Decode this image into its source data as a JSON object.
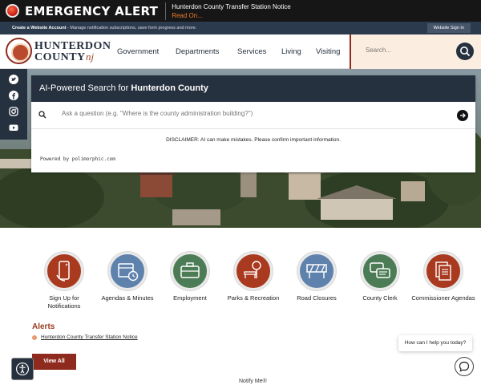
{
  "emergency": {
    "title": "EMERGENCY ALERT",
    "notice": "Hunterdon County Transfer Station Notice",
    "read_on": "Read On..."
  },
  "account_bar": {
    "create_link": "Create a Website Account",
    "create_rest": " - Manage notification subscriptions, save form progress and more.",
    "sign_in": "Website Sign In"
  },
  "header": {
    "logo_line1": "HUNTERDON",
    "logo_line2": "COUNTY",
    "logo_nj": "nj",
    "nav": [
      "Government",
      "Departments",
      "Services",
      "Living",
      "Visiting"
    ],
    "search_placeholder": "Search..."
  },
  "social": [
    "twitter-icon",
    "facebook-icon",
    "instagram-icon",
    "youtube-icon"
  ],
  "ai_search": {
    "heading_prefix": "AI-Powered Search for ",
    "heading_bold": "Hunterdon County",
    "placeholder": "Ask a question (e.g. \"Where is the county administration building?\")",
    "disclaimer": "DISCLAIMER: AI can make mistakes. Please confirm important information.",
    "powered_by": "Powered by polimorphic.com"
  },
  "quick_links": [
    {
      "label": "Sign Up for Notifications",
      "icon": "phone-notification-icon",
      "color": "#a93a1f"
    },
    {
      "label": "Agendas & Minutes",
      "icon": "calendar-clock-icon",
      "color": "#5f82ad"
    },
    {
      "label": "Employment",
      "icon": "briefcase-icon",
      "color": "#4c7c55"
    },
    {
      "label": "Parks & Recreation",
      "icon": "park-bench-icon",
      "color": "#a93a1f"
    },
    {
      "label": "Road Closures",
      "icon": "road-barrier-icon",
      "color": "#5f82ad"
    },
    {
      "label": "County Clerk",
      "icon": "chat-bubbles-icon",
      "color": "#4c7c55"
    },
    {
      "label": "Commissioner Agendas",
      "icon": "documents-icon",
      "color": "#a93a1f"
    }
  ],
  "alerts": {
    "title": "Alerts",
    "items": [
      "Hunterdon County Transfer Station Notice"
    ],
    "view_all": "View All"
  },
  "footer": {
    "notify": "Notify Me®"
  },
  "chat": {
    "prompt": "How can I help you today?"
  }
}
